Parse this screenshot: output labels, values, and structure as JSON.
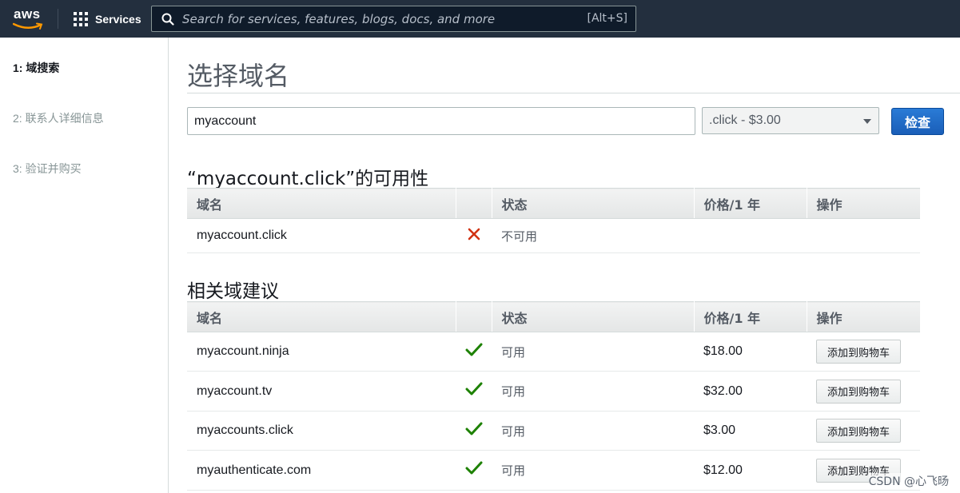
{
  "nav": {
    "logo_text": "aws",
    "services_label": "Services",
    "search_placeholder": "Search for services, features, blogs, docs, and more",
    "search_shortcut": "[Alt+S]"
  },
  "sidebar": {
    "steps": [
      {
        "label": "1: 域搜索",
        "active": true
      },
      {
        "label": "2: 联系人详细信息",
        "active": false
      },
      {
        "label": "3: 验证并购买",
        "active": false
      }
    ]
  },
  "main": {
    "title": "选择域名",
    "domain_input_value": "myaccount",
    "tld_select_value": ".click - $3.00",
    "check_button_label": "检查"
  },
  "availability": {
    "title": "“myaccount.click”的可用性",
    "headers": [
      "域名",
      "",
      "状态",
      "价格/1 年",
      "操作"
    ],
    "rows": [
      {
        "domain": "myaccount.click",
        "available": false,
        "status": "不可用",
        "price": "",
        "action": ""
      }
    ]
  },
  "suggestions": {
    "title": "相关域建议",
    "headers": [
      "域名",
      "",
      "状态",
      "价格/1 年",
      "操作"
    ],
    "rows": [
      {
        "domain": "myaccount.ninja",
        "available": true,
        "status": "可用",
        "price": "$18.00",
        "action": "添加到购物车"
      },
      {
        "domain": "myaccount.tv",
        "available": true,
        "status": "可用",
        "price": "$32.00",
        "action": "添加到购物车"
      },
      {
        "domain": "myaccounts.click",
        "available": true,
        "status": "可用",
        "price": "$3.00",
        "action": "添加到购物车"
      },
      {
        "domain": "myauthenticate.com",
        "available": true,
        "status": "可用",
        "price": "$12.00",
        "action": "添加到购物车"
      }
    ]
  },
  "watermark": "CSDN @心飞旸",
  "colors": {
    "nav_bg": "#232f3e",
    "available_green": "#1d8102",
    "unavailable_red": "#d13212",
    "primary_blue": "#1a5eb8"
  }
}
